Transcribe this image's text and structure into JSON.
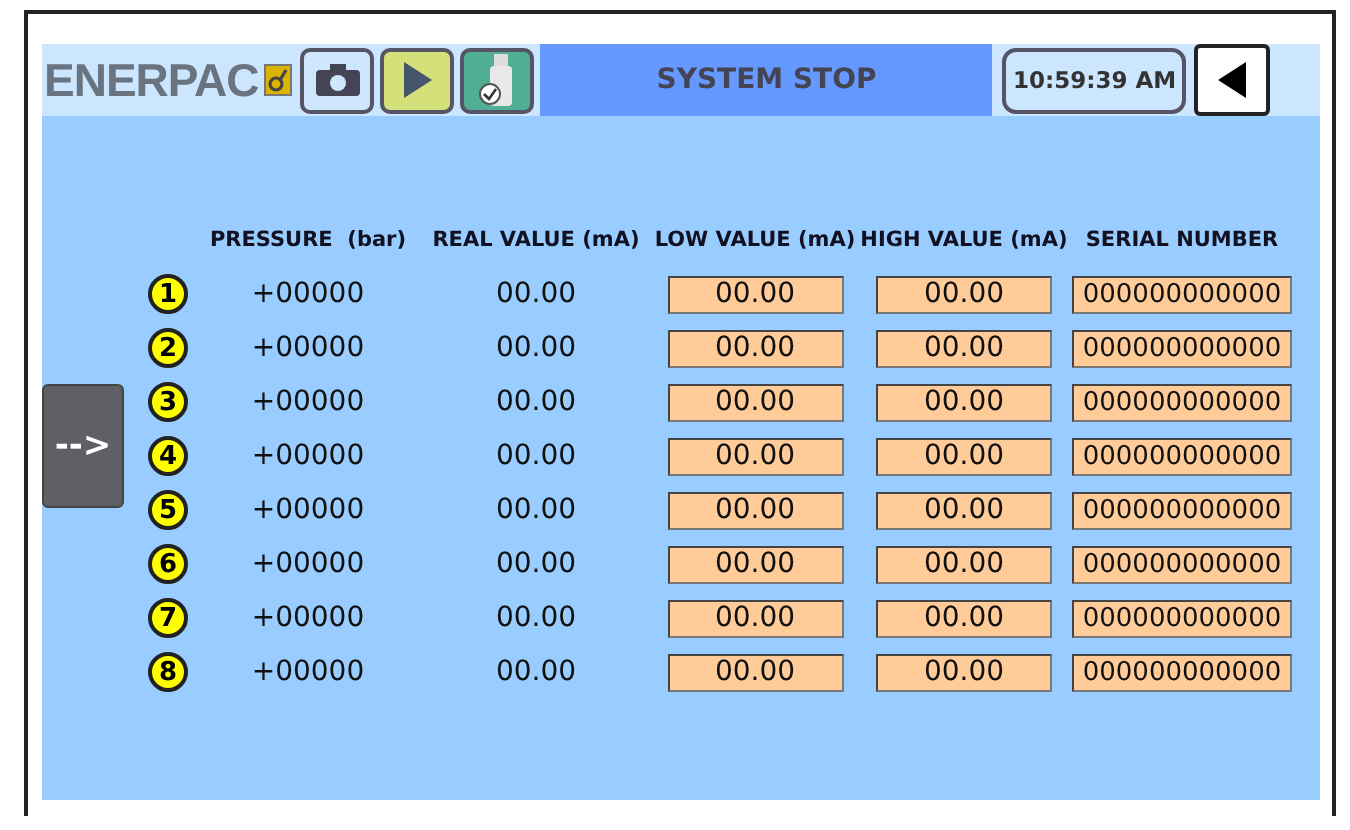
{
  "header": {
    "logo": "ENERPAC",
    "status": "SYSTEM STOP",
    "time": "10:59:39 AM"
  },
  "nav_button": "-->",
  "table": {
    "columns": [
      "PRESSURE  (bar)",
      "REAL VALUE (mA)",
      "LOW VALUE (mA)",
      "HIGH VALUE (mA)",
      "SERIAL NUMBER"
    ],
    "rows": [
      {
        "index": "1",
        "pressure": "+00000",
        "real": "00.00",
        "low": "00.00",
        "high": "00.00",
        "serial": "000000000000"
      },
      {
        "index": "2",
        "pressure": "+00000",
        "real": "00.00",
        "low": "00.00",
        "high": "00.00",
        "serial": "000000000000"
      },
      {
        "index": "3",
        "pressure": "+00000",
        "real": "00.00",
        "low": "00.00",
        "high": "00.00",
        "serial": "000000000000"
      },
      {
        "index": "4",
        "pressure": "+00000",
        "real": "00.00",
        "low": "00.00",
        "high": "00.00",
        "serial": "000000000000"
      },
      {
        "index": "5",
        "pressure": "+00000",
        "real": "00.00",
        "low": "00.00",
        "high": "00.00",
        "serial": "000000000000"
      },
      {
        "index": "6",
        "pressure": "+00000",
        "real": "00.00",
        "low": "00.00",
        "high": "00.00",
        "serial": "000000000000"
      },
      {
        "index": "7",
        "pressure": "+00000",
        "real": "00.00",
        "low": "00.00",
        "high": "00.00",
        "serial": "000000000000"
      },
      {
        "index": "8",
        "pressure": "+00000",
        "real": "00.00",
        "low": "00.00",
        "high": "00.00",
        "serial": "000000000000"
      }
    ]
  }
}
